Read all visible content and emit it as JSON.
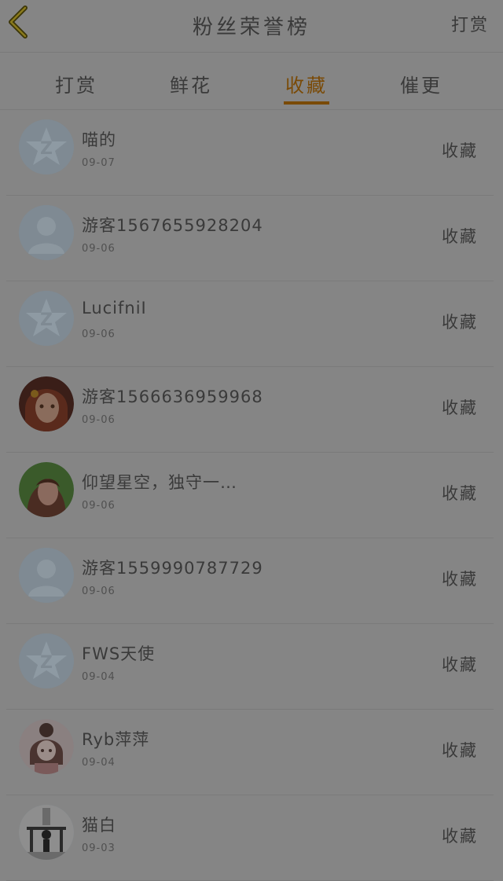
{
  "header": {
    "title": "粉丝荣誉榜",
    "right_label": "打赏",
    "back_icon": "chevron-left-icon",
    "accent": "#7a4a06"
  },
  "tabs": [
    {
      "label": "打赏",
      "active": false
    },
    {
      "label": "鲜花",
      "active": false
    },
    {
      "label": "收藏",
      "active": true
    },
    {
      "label": "催更",
      "active": false
    }
  ],
  "rows": [
    {
      "name": "喵的",
      "date": "09-07",
      "action": "收藏",
      "avatar": "qq-star"
    },
    {
      "name": "游客1567655928204",
      "date": "09-06",
      "action": "收藏",
      "avatar": "person"
    },
    {
      "name": "LucifniI",
      "date": "09-06",
      "action": "收藏",
      "avatar": "qq-star"
    },
    {
      "name": "游客1566636959968",
      "date": "09-06",
      "action": "收藏",
      "avatar": "anime-red"
    },
    {
      "name": "仰望星空，独守一…",
      "date": "09-06",
      "action": "收藏",
      "avatar": "girl-green"
    },
    {
      "name": "游客1559990787729",
      "date": "09-06",
      "action": "收藏",
      "avatar": "person"
    },
    {
      "name": "FWS天使",
      "date": "09-04",
      "action": "收藏",
      "avatar": "qq-star"
    },
    {
      "name": "Ryb萍萍",
      "date": "09-04",
      "action": "收藏",
      "avatar": "anime-pink"
    },
    {
      "name": "猫白",
      "date": "09-03",
      "action": "收藏",
      "avatar": "bw-photo"
    }
  ]
}
